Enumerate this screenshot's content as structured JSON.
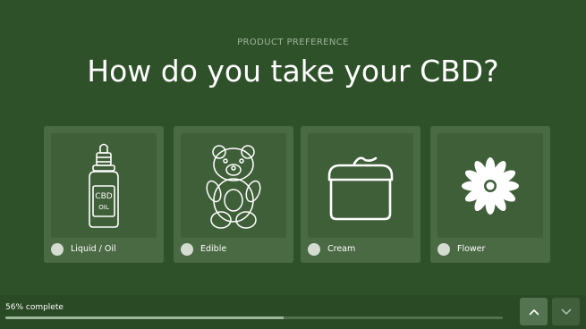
{
  "header": {
    "eyebrow": "PRODUCT PREFERENCE",
    "title": "How do you take your CBD?"
  },
  "options": [
    {
      "label": "Liquid / Oil",
      "icon": "cbd-oil-bottle-icon",
      "selected": false
    },
    {
      "label": "Edible",
      "icon": "gummy-bear-icon",
      "selected": false
    },
    {
      "label": "Cream",
      "icon": "cream-jar-icon",
      "selected": false
    },
    {
      "label": "Flower",
      "icon": "flower-icon",
      "selected": false
    }
  ],
  "oil_bottle_text": {
    "line1": "CBD",
    "line2": "OIL"
  },
  "progress": {
    "text": "56% complete",
    "percent": 56
  },
  "navigation": {
    "up_icon": "chevron-up-icon",
    "down_icon": "chevron-down-icon"
  },
  "colors": {
    "background": "#2f5129",
    "card": "#4a6a43",
    "card_art": "#3f5f39",
    "accent_fill": "#9fb59b"
  }
}
